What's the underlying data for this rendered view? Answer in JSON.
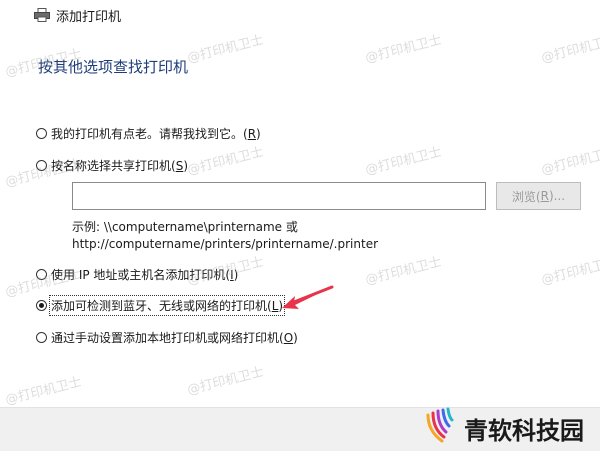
{
  "window": {
    "title": "添加打印机",
    "icon": "printer-icon"
  },
  "heading": "按其他选项查找打印机",
  "options": [
    {
      "label": "我的打印机有点老。请帮我找到它。(",
      "mnemonic": "R",
      "suffix": ")",
      "checked": false
    },
    {
      "label": "按名称选择共享打印机(",
      "mnemonic": "S",
      "suffix": ")",
      "checked": false
    },
    {
      "label": "使用 IP 地址或主机名添加打印机(",
      "mnemonic": "I",
      "suffix": ")",
      "checked": false
    },
    {
      "label": "添加可检测到蓝牙、无线或网络的打印机(",
      "mnemonic": "L",
      "suffix": ")",
      "checked": true
    },
    {
      "label": "通过手动设置添加本地打印机或网络打印机(",
      "mnemonic": "O",
      "suffix": ")",
      "checked": false
    }
  ],
  "shared_printer": {
    "value": "",
    "browse_label": "浏览(",
    "browse_mnemonic": "R",
    "browse_suffix": ")...",
    "example_line1": "示例: \\\\computername\\printername 或",
    "example_line2": "http://computername/printers/printername/.printer"
  },
  "watermark_text": "@打印机卫士",
  "logo_text": "青软科技园",
  "colors": {
    "heading": "#1f3d7a",
    "arrow": "#e8344a",
    "footer": "#f0f0f0"
  }
}
